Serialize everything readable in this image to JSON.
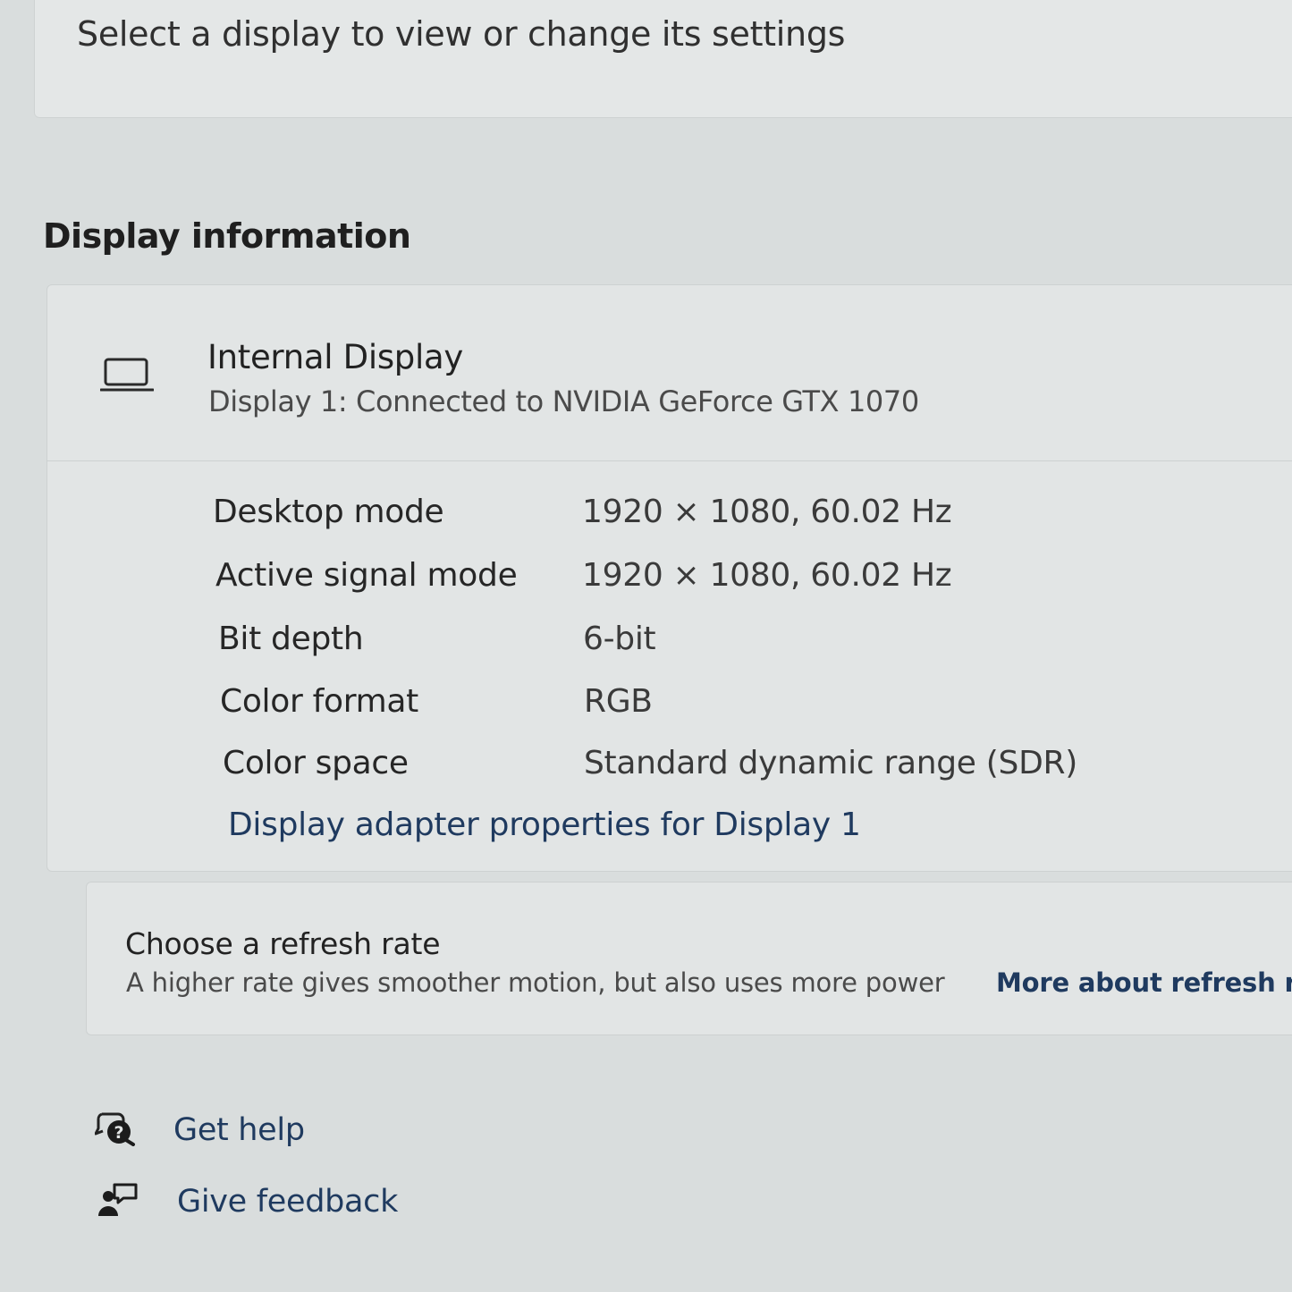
{
  "select_display": {
    "prompt": "Select a display to view or change its settings"
  },
  "display_information": {
    "section_title": "Display information",
    "display_name": "Internal Display",
    "display_subtitle": "Display 1: Connected to NVIDIA GeForce GTX 1070",
    "icon": "laptop-icon",
    "rows": [
      {
        "label": "Desktop mode",
        "value": "1920 × 1080, 60.02 Hz"
      },
      {
        "label": "Active signal mode",
        "value": "1920 × 1080, 60.02 Hz"
      },
      {
        "label": "Bit depth",
        "value": "6-bit"
      },
      {
        "label": "Color format",
        "value": "RGB"
      },
      {
        "label": "Color space",
        "value": "Standard dynamic range (SDR)"
      }
    ],
    "adapter_link": "Display adapter properties for Display 1"
  },
  "refresh_rate": {
    "title": "Choose a refresh rate",
    "description": "A higher rate gives smoother motion, but also uses more power",
    "link": "More about refresh ra"
  },
  "footer": {
    "get_help": "Get help",
    "give_feedback": "Give feedback",
    "get_help_icon": "help-chat-icon",
    "give_feedback_icon": "feedback-icon"
  },
  "colors": {
    "background": "#d9dddd",
    "card": "#e2e5e5",
    "link": "#1f3a5f"
  }
}
